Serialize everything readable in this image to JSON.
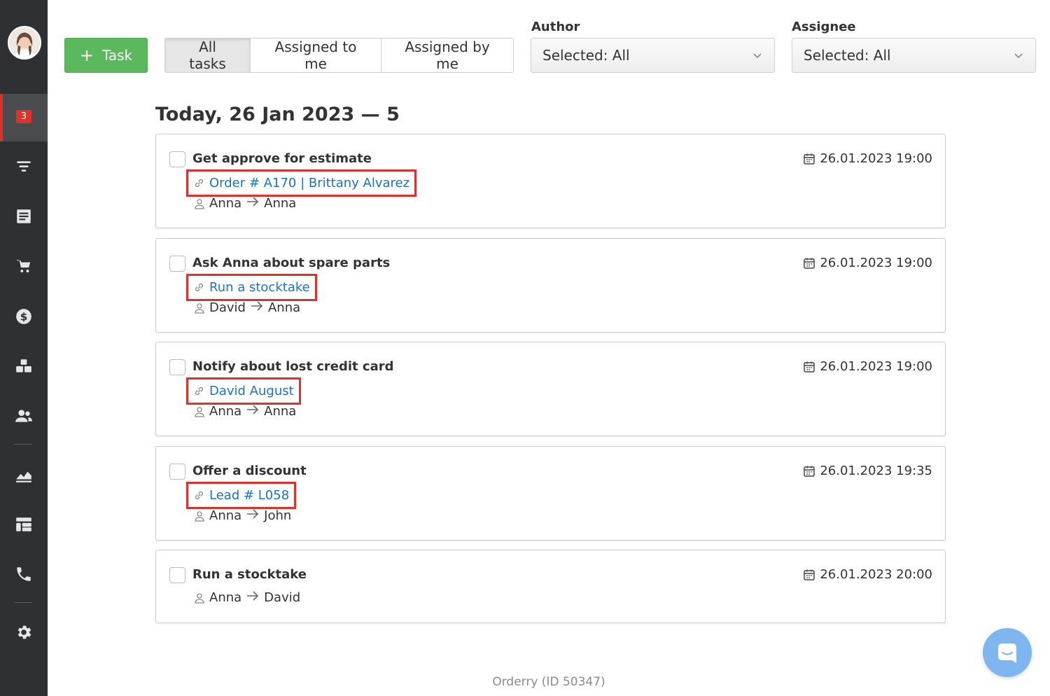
{
  "sidebar": {
    "badge_count": "3",
    "accent": "#e0302a",
    "items": [
      {
        "name": "filter-icon"
      },
      {
        "name": "orders-icon"
      },
      {
        "name": "cart-icon"
      },
      {
        "name": "finance-icon"
      },
      {
        "name": "warehouse-icon"
      },
      {
        "name": "customers-icon"
      },
      {
        "name": "analytics-icon"
      },
      {
        "name": "dashboard-icon"
      },
      {
        "name": "phone-icon"
      },
      {
        "name": "settings-icon"
      }
    ]
  },
  "toolbar": {
    "task_button_label": "Task",
    "tabs": [
      "All tasks",
      "Assigned to me",
      "Assigned by me"
    ],
    "active_tab": "All tasks",
    "author_label": "Author",
    "author_value": "Selected: All",
    "assignee_label": "Assignee",
    "assignee_value": "Selected: All"
  },
  "day": {
    "title": "Today, 26 Jan 2023 — 5"
  },
  "tasks": [
    {
      "title": "Get approve for estimate",
      "date": "26.01.2023 19:00",
      "link": "Order # A170 | Brittany Alvarez",
      "from": "Anna",
      "to": "Anna"
    },
    {
      "title": "Ask Anna about spare parts",
      "date": "26.01.2023 19:00",
      "link": "Run a stocktake",
      "from": "David",
      "to": "Anna"
    },
    {
      "title": "Notify about lost credit card",
      "date": "26.01.2023 19:00",
      "link": "David August",
      "from": "Anna",
      "to": "Anna"
    },
    {
      "title": "Offer a discount",
      "date": "26.01.2023 19:35",
      "link": "Lead # L058",
      "from": "Anna",
      "to": "John"
    },
    {
      "title": "Run a stocktake",
      "date": "26.01.2023 20:00",
      "link": "",
      "from": "Anna",
      "to": "David"
    }
  ],
  "footer": {
    "text": "Orderry (ID 50347)"
  }
}
